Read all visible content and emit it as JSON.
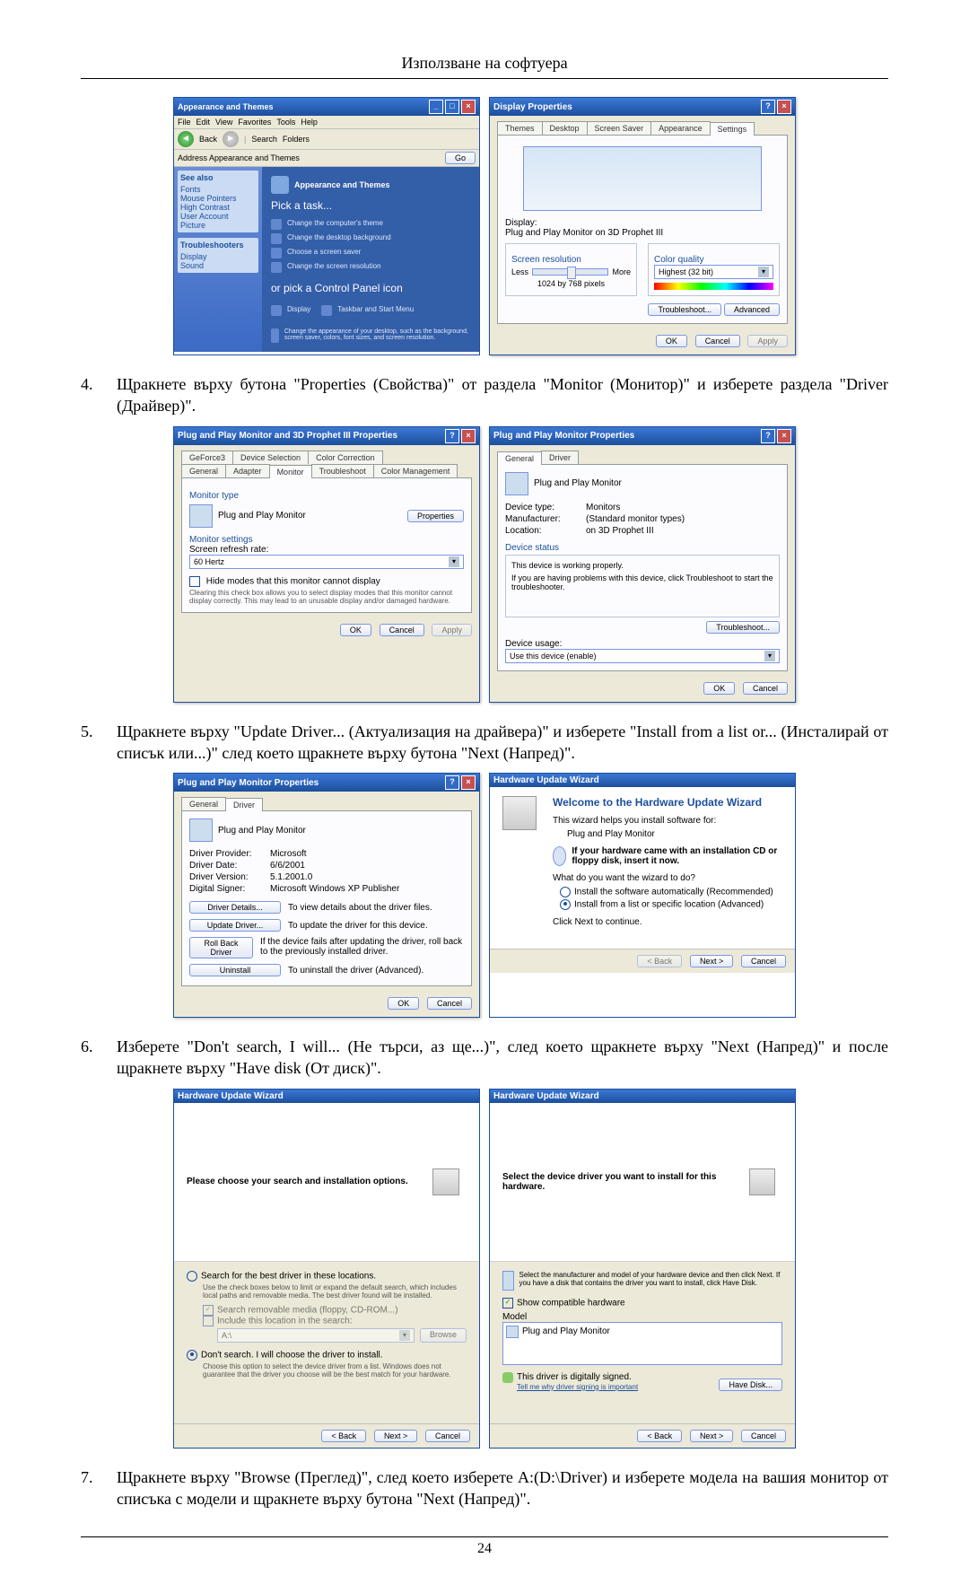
{
  "header_title": "Използване на софтуера",
  "page_number": "24",
  "screenshots": {
    "control_panel": {
      "title": "Appearance and Themes",
      "menu": [
        "File",
        "Edit",
        "View",
        "Favorites",
        "Tools",
        "Help"
      ],
      "toolbar": {
        "back": "Back",
        "search": "Search",
        "folders": "Folders"
      },
      "address": "Address  Appearance and Themes",
      "sidebar_see_also": "See also",
      "sidebar_items": [
        "Fonts",
        "Mouse Pointers",
        "High Contrast",
        "User Account Picture"
      ],
      "sidebar_troubleshoot": "Troubleshooters",
      "sidebar_ts_items": [
        "Display",
        "Sound"
      ],
      "content_header": "Appearance and Themes",
      "pick_task": "Pick a task...",
      "tasks": [
        "Change the computer's theme",
        "Change the desktop background",
        "Choose a screen saver",
        "Change the screen resolution"
      ],
      "or_pick": "or pick a Control Panel icon",
      "cp_icons": [
        "Display",
        "Taskbar and Start Menu"
      ],
      "hint": "Change the appearance of your desktop, such as the background, screen saver, colors, font sizes, and screen resolution."
    },
    "display_properties": {
      "title": "Display Properties",
      "tabs": [
        "Themes",
        "Desktop",
        "Screen Saver",
        "Appearance",
        "Settings"
      ],
      "display_label": "Display:",
      "display_value": "Plug and Play Monitor on 3D Prophet III",
      "res_label": "Screen resolution",
      "res_less": "Less",
      "res_more": "More",
      "res_value": "1024 by 768 pixels",
      "color_label": "Color quality",
      "color_value": "Highest (32 bit)",
      "troubleshoot": "Troubleshoot...",
      "advanced": "Advanced",
      "ok": "OK",
      "cancel": "Cancel",
      "apply": "Apply"
    },
    "monitor_3d_props": {
      "title": "Plug and Play Monitor and 3D Prophet III Properties",
      "tabs_row1": [
        "GeForce3",
        "Device Selection",
        "Color Correction"
      ],
      "tabs_row2": [
        "General",
        "Adapter",
        "Monitor",
        "Troubleshoot",
        "Color Management"
      ],
      "monitor_type": "Monitor type",
      "monitor_name": "Plug and Play Monitor",
      "properties_btn": "Properties",
      "monitor_settings": "Monitor settings",
      "refresh_label": "Screen refresh rate:",
      "refresh_value": "60 Hertz",
      "hide_modes": "Hide modes that this monitor cannot display",
      "hide_modes_desc": "Clearing this check box allows you to select display modes that this monitor cannot display correctly. This may lead to an unusable display and/or damaged hardware.",
      "ok": "OK",
      "cancel": "Cancel",
      "apply": "Apply"
    },
    "monitor_props": {
      "title": "Plug and Play Monitor Properties",
      "tabs": [
        "General",
        "Driver"
      ],
      "name": "Plug and Play Monitor",
      "device_type_label": "Device type:",
      "device_type": "Monitors",
      "manufacturer_label": "Manufacturer:",
      "manufacturer": "(Standard monitor types)",
      "location_label": "Location:",
      "location": "on 3D Prophet III",
      "device_status": "Device status",
      "status_text": "This device is working properly.",
      "status_hint": "If you are having problems with this device, click Troubleshoot to start the troubleshooter.",
      "troubleshoot_btn": "Troubleshoot...",
      "device_usage": "Device usage:",
      "usage_value": "Use this device (enable)",
      "ok": "OK",
      "cancel": "Cancel"
    },
    "driver_tab": {
      "title": "Plug and Play Monitor Properties",
      "tabs": [
        "General",
        "Driver"
      ],
      "name": "Plug and Play Monitor",
      "provider_label": "Driver Provider:",
      "provider": "Microsoft",
      "date_label": "Driver Date:",
      "date": "6/6/2001",
      "version_label": "Driver Version:",
      "version": "5.1.2001.0",
      "signer_label": "Digital Signer:",
      "signer": "Microsoft Windows XP Publisher",
      "details_btn": "Driver Details...",
      "details_desc": "To view details about the driver files.",
      "update_btn": "Update Driver...",
      "update_desc": "To update the driver for this device.",
      "rollback_btn": "Roll Back Driver",
      "rollback_desc": "If the device fails after updating the driver, roll back to the previously installed driver.",
      "uninstall_btn": "Uninstall",
      "uninstall_desc": "To uninstall the driver (Advanced).",
      "ok": "OK",
      "cancel": "Cancel"
    },
    "hw_wizard_welcome": {
      "title": "Hardware Update Wizard",
      "heading": "Welcome to the Hardware Update Wizard",
      "intro": "This wizard helps you install software for:",
      "device": "Plug and Play Monitor",
      "cd_hint": "If your hardware came with an installation CD or floppy disk, insert it now.",
      "want": "What do you want the wizard to do?",
      "opt_auto": "Install the software automatically (Recommended)",
      "opt_list": "Install from a list or specific location (Advanced)",
      "click_next": "Click Next to continue.",
      "back": "< Back",
      "next": "Next >",
      "cancel": "Cancel"
    },
    "hw_wizard_search": {
      "title": "Hardware Update Wizard",
      "header": "Please choose your search and installation options.",
      "opt_search": "Search for the best driver in these locations.",
      "search_hint": "Use the check boxes below to limit or expand the default search, which includes local paths and removable media. The best driver found will be installed.",
      "chk_media": "Search removable media (floppy, CD-ROM...)",
      "chk_include": "Include this location in the search:",
      "path": "A:\\",
      "browse": "Browse",
      "opt_dont": "Don't search. I will choose the driver to install.",
      "dont_hint": "Choose this option to select the device driver from a list. Windows does not guarantee that the driver you choose will be the best match for your hardware.",
      "back": "< Back",
      "next": "Next >",
      "cancel": "Cancel"
    },
    "hw_wizard_select": {
      "title": "Hardware Update Wizard",
      "header": "Select the device driver you want to install for this hardware.",
      "hint": "Select the manufacturer and model of your hardware device and then click Next. If you have a disk that contains the driver you want to install, click Have Disk.",
      "show_compat": "Show compatible hardware",
      "model": "Model",
      "item": "Plug and Play Monitor",
      "signed": "This driver is digitally signed.",
      "why_link": "Tell me why driver signing is important",
      "have_disk": "Have Disk...",
      "back": "< Back",
      "next": "Next >",
      "cancel": "Cancel"
    }
  },
  "steps": {
    "s4": {
      "num": "4.",
      "text": "Щракнете върху бутона \"Properties (Свойства)\" от раздела \"Monitor (Монитор)\" и изберете раздела \"Driver (Драйвер)\"."
    },
    "s5": {
      "num": "5.",
      "text": "Щракнете върху \"Update Driver... (Актуализация на драйвера)\" и изберете \"Install from a list or... (Инсталирай от списък или...)\" след което щракнете върху бутона \"Next (Напред)\"."
    },
    "s6": {
      "num": "6.",
      "text": "Изберете \"Don't search, I will... (Не търси, аз ще...)\", след което щракнете върху \"Next (Напред)\" и после щракнете върху \"Have disk (От диск)\"."
    },
    "s7": {
      "num": "7.",
      "text": "Щракнете върху \"Browse (Преглед)\", след което изберете A:(D:\\Driver) и изберете модела на вашия монитор от списъка с модели и щракнете върху бутона \"Next (Напред)\"."
    }
  }
}
